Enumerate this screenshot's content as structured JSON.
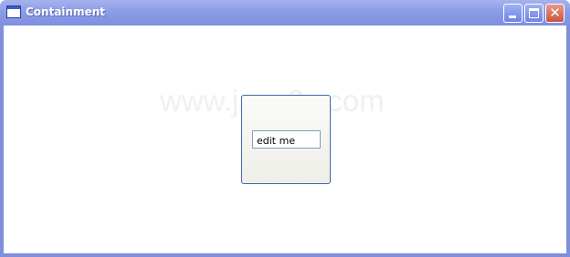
{
  "window": {
    "title": "Containment",
    "buttons": {
      "minimize": "minimize",
      "maximize": "maximize",
      "close": "close"
    }
  },
  "content": {
    "watermark": "www.java2s.com",
    "textbox": {
      "value": "edit me"
    }
  },
  "colors": {
    "titlebar": "#8d9ce6",
    "panel_border": "#3c6aa6",
    "close_button": "#c8553f"
  },
  "icons": [
    "window-icon",
    "minimize-icon",
    "maximize-icon",
    "close-icon"
  ]
}
